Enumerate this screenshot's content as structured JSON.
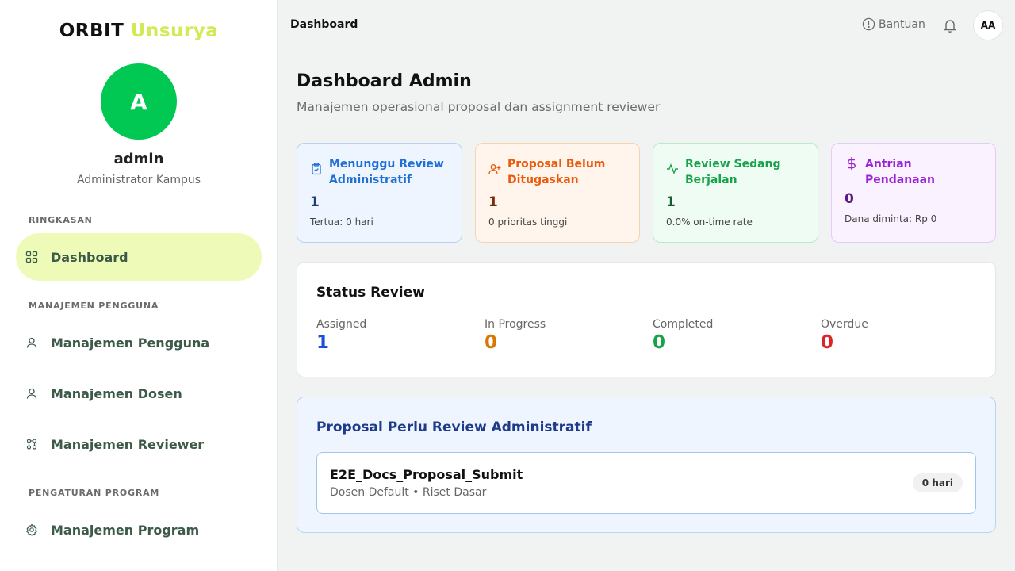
{
  "brand": {
    "part1": "ORBIT",
    "part2": "Unsurya"
  },
  "user": {
    "initial": "A",
    "name": "admin",
    "role": "Administrator Kampus"
  },
  "sidebar": {
    "sections": [
      {
        "label": "RINGKASAN"
      },
      {
        "label": "MANAJEMEN PENGGUNA"
      },
      {
        "label": "PENGATURAN PROGRAM"
      }
    ],
    "items": [
      {
        "label": "Dashboard",
        "icon": "grid-icon",
        "active": true
      },
      {
        "label": "Manajemen Pengguna",
        "icon": "user-icon"
      },
      {
        "label": "Manajemen Dosen",
        "icon": "user-icon"
      },
      {
        "label": "Manajemen Reviewer",
        "icon": "users-network-icon"
      },
      {
        "label": "Manajemen Program",
        "icon": "gear-icon"
      }
    ]
  },
  "topbar": {
    "title": "Dashboard",
    "help_label": "Bantuan",
    "avatar_initials": "AA"
  },
  "header": {
    "title": "Dashboard Admin",
    "subtitle": "Manajemen operasional proposal dan assignment reviewer"
  },
  "cards": [
    {
      "title": "Menunggu Review Administratif",
      "value": "1",
      "note": "Tertua: 0 hari",
      "icon": "clipboard-icon",
      "color": "#1f6fd6"
    },
    {
      "title": "Proposal Belum Ditugaskan",
      "value": "1",
      "note": "0 prioritas tinggi",
      "icon": "user-plus-icon",
      "color": "#ea5a0c"
    },
    {
      "title": "Review Sedang Berjalan",
      "value": "1",
      "note": "0.0% on-time rate",
      "icon": "activity-icon",
      "color": "#17a34a"
    },
    {
      "title": "Antrian Pendanaan",
      "value": "0",
      "note": "Dana diminta: Rp 0",
      "icon": "dollar-icon",
      "color": "#9b22d6"
    }
  ],
  "status_review": {
    "title": "Status Review",
    "stats": [
      {
        "label": "Assigned",
        "value": "1",
        "color": "#1d4ed8"
      },
      {
        "label": "In Progress",
        "value": "0",
        "color": "#d97706"
      },
      {
        "label": "Completed",
        "value": "0",
        "color": "#16a34a"
      },
      {
        "label": "Overdue",
        "value": "0",
        "color": "#dc2626"
      }
    ]
  },
  "proposals": {
    "title": "Proposal Perlu Review Administratif",
    "items": [
      {
        "name": "E2E_Docs_Proposal_Submit",
        "meta": "Dosen Default • Riset Dasar",
        "badge": "0 hari"
      }
    ]
  }
}
